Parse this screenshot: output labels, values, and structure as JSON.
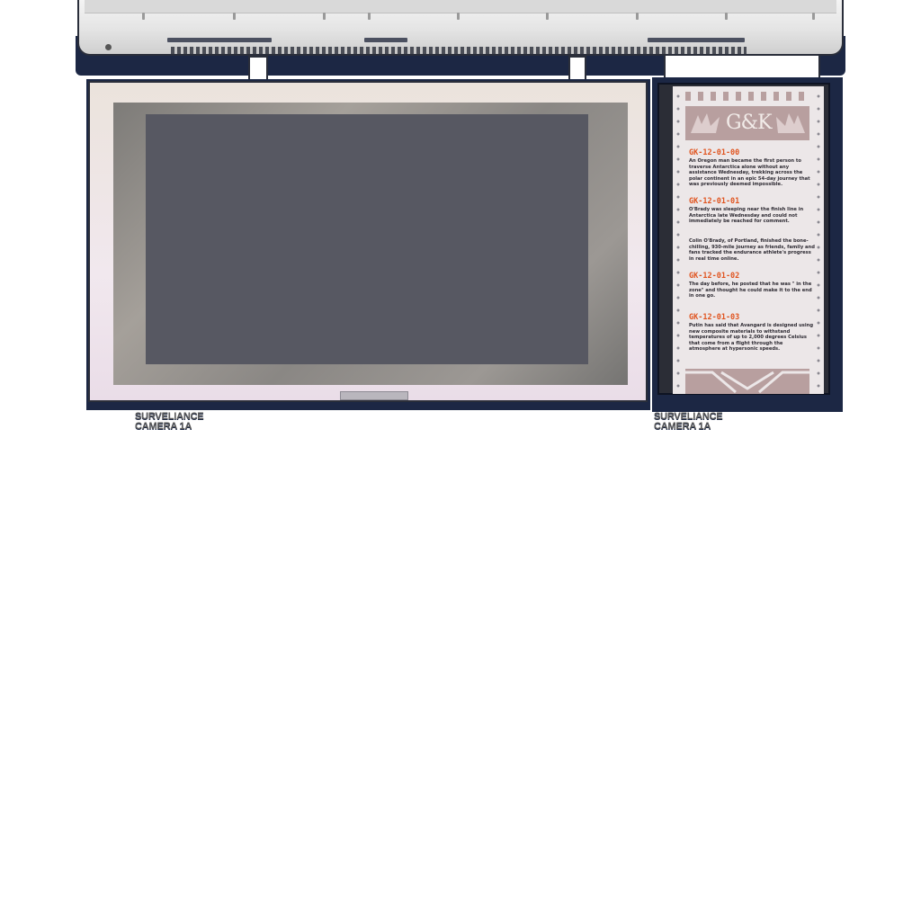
{
  "labels": {
    "left_camera_line1": "SURVELIANCE",
    "left_camera_line2": "CAMERA 1A",
    "right_camera_line1": "SURVELIANCE",
    "right_camera_line2": "CAMERA 1A"
  },
  "feed": {
    "logo": "G&K",
    "entries": [
      {
        "id": "GK-12-01-00",
        "text": "An Oregon man became the first person to traverse Antarctica alone without any assistance Wednesday, trekking across the polar continent in an epic 54-day journey that was previously deemed impossible."
      },
      {
        "id": "GK-12-01-01",
        "text": "O'Brady was sleeping near the finish line in Antarctica late Wednesday and could not immediately be reached for comment."
      },
      {
        "id": "",
        "text": "Colin O'Brady, of Portland, finished the bone-chilling, 930-mile journey as friends, family and fans tracked the endurance athlete's progress in real time online."
      },
      {
        "id": "GK-12-01-02",
        "text": "The day before, he posted that he was \" in the zone\" and thought he could make it to the end in one go."
      },
      {
        "id": "GK-12-01-03",
        "text": "Putin has said that Avangard is designed using new composite materials to withstand temperatures of up to 2,000 degrees Celsius that come from a flight through the atmosphere at hypersonic speeds."
      }
    ]
  },
  "colors": {
    "frame_navy": "#1c2744",
    "screen_gray": "#575862",
    "feed_id_orange": "#e0541f",
    "logo_band_mauve": "#b89f9f"
  }
}
